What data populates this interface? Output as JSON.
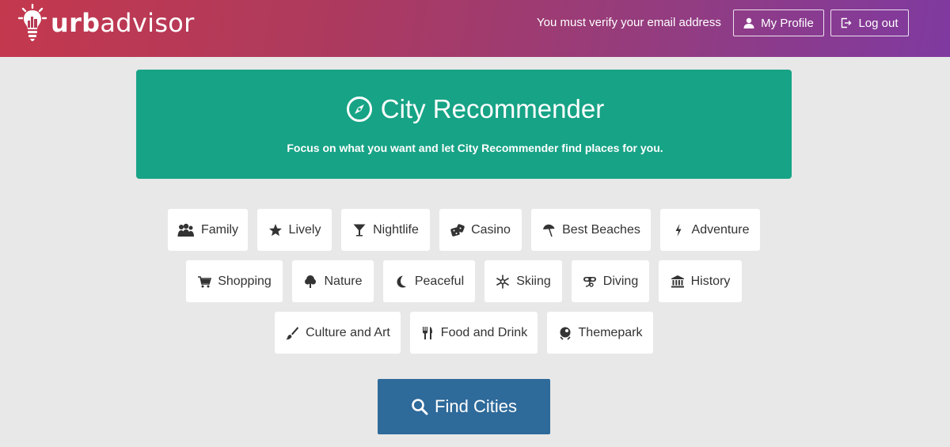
{
  "header": {
    "logo_text_bold": "urb",
    "logo_text_rest": "advisor",
    "verify_message": "You must verify your email address",
    "profile_button": "My Profile",
    "logout_button": "Log out"
  },
  "hero": {
    "title": "City Recommender",
    "subtitle": "Focus on what you want and let City Recommender find places for you."
  },
  "categories": [
    {
      "label": "Family",
      "icon": "family-icon"
    },
    {
      "label": "Lively",
      "icon": "star-icon"
    },
    {
      "label": "Nightlife",
      "icon": "cocktail-icon"
    },
    {
      "label": "Casino",
      "icon": "dice-icon"
    },
    {
      "label": "Best Beaches",
      "icon": "umbrella-icon"
    },
    {
      "label": "Adventure",
      "icon": "lightning-icon"
    },
    {
      "label": "Shopping",
      "icon": "cart-icon"
    },
    {
      "label": "Nature",
      "icon": "tree-icon"
    },
    {
      "label": "Peaceful",
      "icon": "moon-icon"
    },
    {
      "label": "Skiing",
      "icon": "snowflake-icon"
    },
    {
      "label": "Diving",
      "icon": "goggles-icon"
    },
    {
      "label": "History",
      "icon": "museum-icon"
    },
    {
      "label": "Culture and Art",
      "icon": "brush-icon"
    },
    {
      "label": "Food and Drink",
      "icon": "fork-knife-icon"
    },
    {
      "label": "Themepark",
      "icon": "rollercoaster-icon"
    }
  ],
  "find_button": "Find Cities",
  "colors": {
    "header_gradient_start": "#c4384d",
    "header_gradient_end": "#7f3aa0",
    "hero_bg": "#17a386",
    "find_button_bg": "#2e6a9a",
    "page_bg": "#e8e8e8"
  }
}
